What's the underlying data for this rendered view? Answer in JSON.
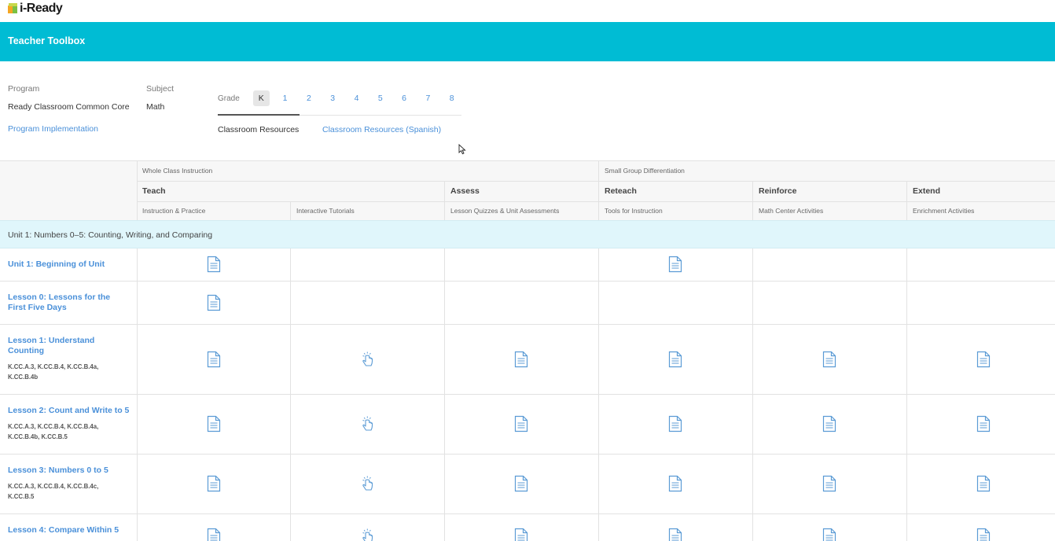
{
  "app": {
    "logo_text": "i-Ready"
  },
  "header": {
    "title": "Teacher Toolbox"
  },
  "filters": {
    "program_label": "Program",
    "program_value": "Ready Classroom Common Core",
    "program_link": "Program Implementation",
    "subject_label": "Subject",
    "subject_value": "Math",
    "grade_label": "Grade",
    "grades": [
      "K",
      "1",
      "2",
      "3",
      "4",
      "5",
      "6",
      "7",
      "8"
    ],
    "selected_grade": "K",
    "resource_tabs": [
      "Classroom Resources",
      "Classroom Resources (Spanish)"
    ],
    "selected_resource_tab": "Classroom Resources"
  },
  "table": {
    "groups": [
      "Whole Class Instruction",
      "Small Group Differentiation"
    ],
    "columns": [
      {
        "title": "Teach",
        "sub": "Instruction & Practice"
      },
      {
        "title": "",
        "sub": "Interactive Tutorials"
      },
      {
        "title": "Assess",
        "sub": "Lesson Quizzes & Unit Assessments"
      },
      {
        "title": "Reteach",
        "sub": "Tools for Instruction"
      },
      {
        "title": "Reinforce",
        "sub": "Math Center Activities"
      },
      {
        "title": "Extend",
        "sub": "Enrichment Activities"
      }
    ],
    "unit_title": "Unit 1: Numbers 0–5: Counting, Writing, and Comparing",
    "rows": [
      {
        "title": "Unit 1: Beginning of Unit",
        "standards": "",
        "cells": [
          "doc",
          "",
          "",
          "doc",
          "",
          ""
        ]
      },
      {
        "title": "Lesson 0: Lessons for the First Five Days",
        "standards": "",
        "cells": [
          "doc",
          "",
          "",
          "",
          "",
          ""
        ]
      },
      {
        "title": "Lesson 1: Understand Counting",
        "standards": "K.CC.A.3, K.CC.B.4, K.CC.B.4a, K.CC.B.4b",
        "cells": [
          "doc",
          "touch",
          "doc",
          "doc",
          "doc",
          "doc"
        ]
      },
      {
        "title": "Lesson 2: Count and Write to 5",
        "standards": "K.CC.A.3, K.CC.B.4, K.CC.B.4a, K.CC.B.4b, K.CC.B.5",
        "cells": [
          "doc",
          "touch",
          "doc",
          "doc",
          "doc",
          "doc"
        ]
      },
      {
        "title": "Lesson 3: Numbers 0 to 5",
        "standards": "K.CC.A.3, K.CC.B.4, K.CC.B.4c, K.CC.B.5",
        "cells": [
          "doc",
          "touch",
          "doc",
          "doc",
          "doc",
          "doc"
        ]
      },
      {
        "title": "Lesson 4: Compare Within 5",
        "standards": "",
        "cells": [
          "doc",
          "touch",
          "doc",
          "doc",
          "doc",
          "doc"
        ]
      }
    ]
  },
  "icons": {
    "doc": "document-icon",
    "touch": "touch-gesture-icon"
  },
  "colors": {
    "header_band": "#00bcd4",
    "link": "#4a90d9",
    "unit_band": "#e0f6fb"
  }
}
